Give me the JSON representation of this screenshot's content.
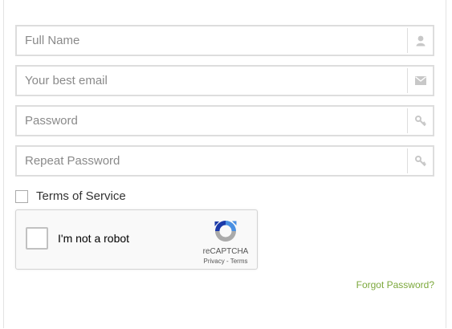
{
  "form": {
    "full_name": {
      "placeholder": "Full Name",
      "value": "",
      "icon": "user-icon"
    },
    "email": {
      "placeholder": "Your best email",
      "value": "",
      "icon": "envelope-icon"
    },
    "password": {
      "placeholder": "Password",
      "value": "",
      "icon": "key-icon"
    },
    "repeat_password": {
      "placeholder": "Repeat Password",
      "value": "",
      "icon": "key-icon"
    },
    "terms": {
      "label": "Terms of Service",
      "checked": false
    }
  },
  "recaptcha": {
    "label": "I'm not a robot",
    "brand": "reCAPTCHA",
    "privacy": "Privacy",
    "separator": " - ",
    "terms": "Terms",
    "checked": false
  },
  "links": {
    "forgot_password": "Forgot Password?"
  },
  "colors": {
    "field_border": "#dddddd",
    "icon": "#c8c8c8",
    "link_green": "#7ca83c",
    "recaptcha_blue": "#4a90e2",
    "recaptcha_gray": "#aaaaaa"
  }
}
